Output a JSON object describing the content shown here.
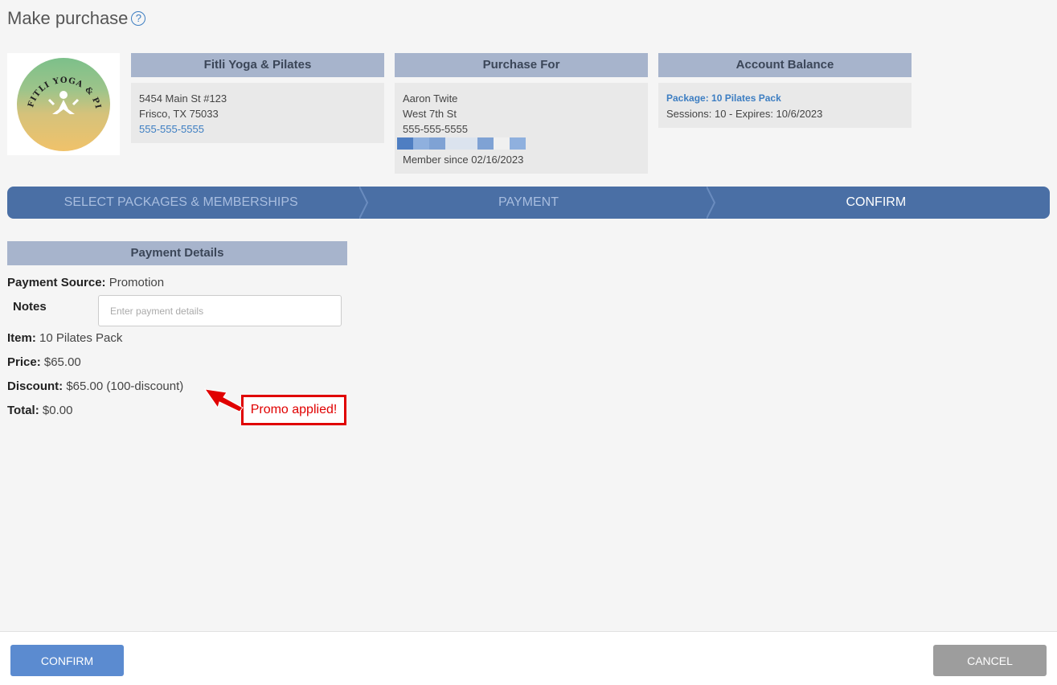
{
  "page": {
    "title": "Make purchase",
    "help_icon": "?"
  },
  "studio": {
    "heading": "Fitli Yoga & Pilates",
    "address1": "5454 Main St #123",
    "address2": "Frisco, TX 75033",
    "phone": "555-555-5555"
  },
  "purchase_for": {
    "heading": "Purchase For",
    "name": "Aaron Twite",
    "street": "West 7th St",
    "phone": "555-555-5555",
    "member_since": "Member since 02/16/2023"
  },
  "account_balance": {
    "heading": "Account Balance",
    "package": "Package: 10 Pilates Pack",
    "sessions": "Sessions: 10 - Expires: 10/6/2023"
  },
  "steps": [
    {
      "label": "SELECT PACKAGES & MEMBERSHIPS"
    },
    {
      "label": "PAYMENT"
    },
    {
      "label": "CONFIRM"
    }
  ],
  "payment_details": {
    "heading": "Payment Details",
    "source_label": "Payment Source:",
    "source_value": "Promotion",
    "notes_label": "Notes",
    "notes_placeholder": "Enter payment details",
    "item_label": "Item:",
    "item_value": "10 Pilates Pack",
    "price_label": "Price:",
    "price_value": "$65.00",
    "discount_label": "Discount:",
    "discount_value": "$65.00 (100-discount)",
    "total_label": "Total:",
    "total_value": "$0.00"
  },
  "annotation": {
    "promo": "Promo applied!"
  },
  "footer": {
    "confirm": "CONFIRM",
    "cancel": "CANCEL"
  },
  "colors": {
    "accent": "#4a6fa5",
    "header_bar": "#a7b4cc",
    "annotation": "#e00000"
  }
}
